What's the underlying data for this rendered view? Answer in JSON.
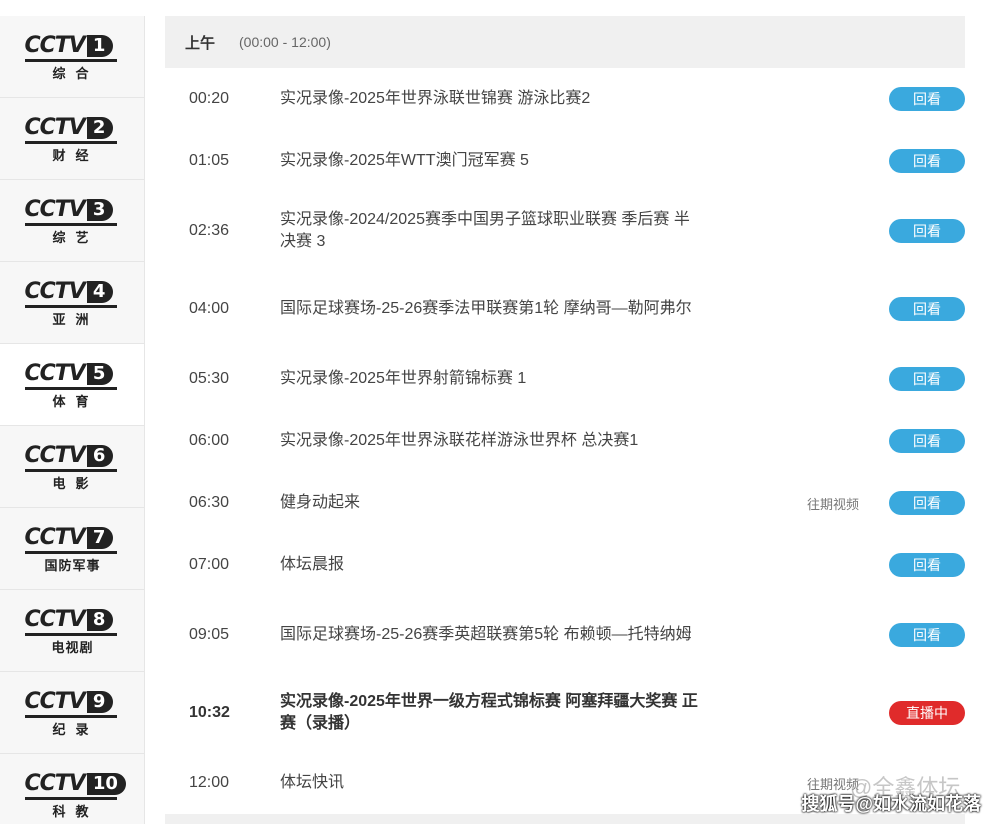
{
  "channels": [
    {
      "logo": "CCTV",
      "num": "1",
      "name": "综合"
    },
    {
      "logo": "CCTV",
      "num": "2",
      "name": "财经"
    },
    {
      "logo": "CCTV",
      "num": "3",
      "name": "综艺"
    },
    {
      "logo": "CCTV",
      "num": "4",
      "name": "亚洲"
    },
    {
      "logo": "CCTV",
      "num": "5",
      "name": "体育"
    },
    {
      "logo": "CCTV",
      "num": "6",
      "name": "电影"
    },
    {
      "logo": "CCTV",
      "num": "7",
      "name": "国防军事"
    },
    {
      "logo": "CCTV",
      "num": "8",
      "name": "电视剧"
    },
    {
      "logo": "CCTV",
      "num": "9",
      "name": "纪录"
    },
    {
      "logo": "CCTV",
      "num": "10",
      "name": "科教"
    }
  ],
  "period": {
    "label": "上午",
    "range": "(00:00 - 12:00)"
  },
  "schedule": [
    {
      "time": "00:20",
      "title": "实况录像-2025年世界泳联世锦赛 游泳比赛2",
      "past": "",
      "button": "回看"
    },
    {
      "time": "01:05",
      "title": "实况录像-2025年WTT澳门冠军赛 5",
      "past": "",
      "button": "回看"
    },
    {
      "time": "02:36",
      "title": "实况录像-2024/2025赛季中国男子篮球职业联赛 季后赛 半决赛 3",
      "past": "",
      "button": "回看"
    },
    {
      "time": "04:00",
      "title": "国际足球赛场-25-26赛季法甲联赛第1轮 摩纳哥—勒阿弗尔",
      "past": "",
      "button": "回看"
    },
    {
      "time": "05:30",
      "title": "实况录像-2025年世界射箭锦标赛 1",
      "past": "",
      "button": "回看"
    },
    {
      "time": "06:00",
      "title": "实况录像-2025年世界泳联花样游泳世界杯 总决赛1",
      "past": "",
      "button": "回看"
    },
    {
      "time": "06:30",
      "title": "健身动起来",
      "past": "往期视频",
      "button": "回看"
    },
    {
      "time": "07:00",
      "title": "体坛晨报",
      "past": "",
      "button": "回看"
    },
    {
      "time": "09:05",
      "title": "国际足球赛场-25-26赛季英超联赛第5轮 布赖顿—托特纳姆",
      "past": "",
      "button": "回看"
    },
    {
      "time": "10:32",
      "title": "实况录像-2025年世界一级方程式锦标赛 阿塞拜疆大奖赛 正赛（录播）",
      "past": "",
      "button": "直播中"
    },
    {
      "time": "12:00",
      "title": "体坛快讯",
      "past": "往期视频",
      "button": ""
    }
  ],
  "watermark": {
    "text": "搜狐号@如水流如花落",
    "faint": "@全鑫体坛"
  },
  "colors": {
    "replay_button": "#3aa9de",
    "live_button": "#e02b2b",
    "period_bg": "#f0f0f0"
  }
}
